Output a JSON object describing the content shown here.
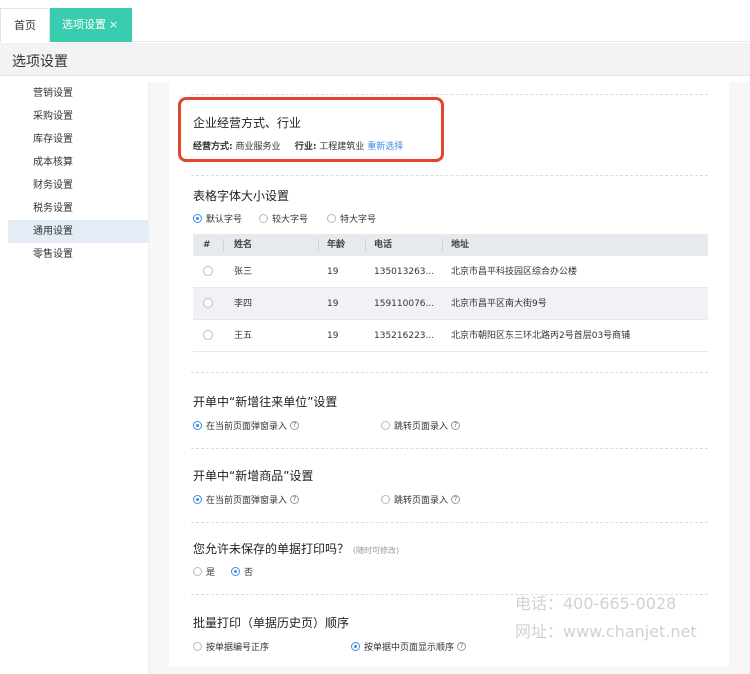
{
  "tabs": {
    "home": "首页",
    "current": "选项设置",
    "close": "×"
  },
  "page_title": "选项设置",
  "sidebar": {
    "items": [
      "营销设置",
      "采购设置",
      "库存设置",
      "成本核算",
      "财务设置",
      "税务设置",
      "通用设置",
      "零售设置"
    ],
    "active_index": 6
  },
  "business": {
    "title": "企业经营方式、行业",
    "mode_label": "经营方式:",
    "mode_value": "商业服务业",
    "industry_label": "行业:",
    "industry_value": "工程建筑业",
    "reselect_link": "重新选择"
  },
  "font_size": {
    "title": "表格字体大小设置",
    "options": [
      "默认字号",
      "较大字号",
      "特大字号"
    ],
    "selected": 0
  },
  "table": {
    "headers": [
      "#",
      "姓名",
      "年龄",
      "电话",
      "地址"
    ],
    "rows": [
      {
        "name": "张三",
        "age": "19",
        "tel": "135013263...",
        "addr": "北京市昌平科技园区综合办公楼"
      },
      {
        "name": "李四",
        "age": "19",
        "tel": "159110076...",
        "addr": "北京市昌平区南大街9号"
      },
      {
        "name": "王五",
        "age": "19",
        "tel": "135216223...",
        "addr": "北京市朝阳区东三环北路丙2号首层03号商铺"
      }
    ]
  },
  "new_partner": {
    "title": "开单中“新增往来单位”设置",
    "opt1": "在当前页面弹窗录入",
    "opt2": "跳转页面录入",
    "selected": 0
  },
  "new_product": {
    "title": "开单中“新增商品”设置",
    "opt1": "在当前页面弹窗录入",
    "opt2": "跳转页面录入",
    "selected": 0
  },
  "print_unsaved": {
    "title": "您允许未保存的单据打印吗？",
    "hint": "(随时可修改)",
    "opt_yes": "是",
    "opt_no": "否",
    "selected": 1
  },
  "batch_print": {
    "title": "批量打印（单据历史页）顺序",
    "opt1": "按单据编号正序",
    "opt2": "按单据中页面显示顺序",
    "selected": 1
  },
  "watermark": {
    "phone": "电话：400-665-0028",
    "site": "网址：www.chanjet.net"
  },
  "colors": {
    "tab_active": "#39cdb0",
    "highlight": "#e4432f",
    "radio": "#3a8ee6",
    "link": "#3a8ee6"
  }
}
